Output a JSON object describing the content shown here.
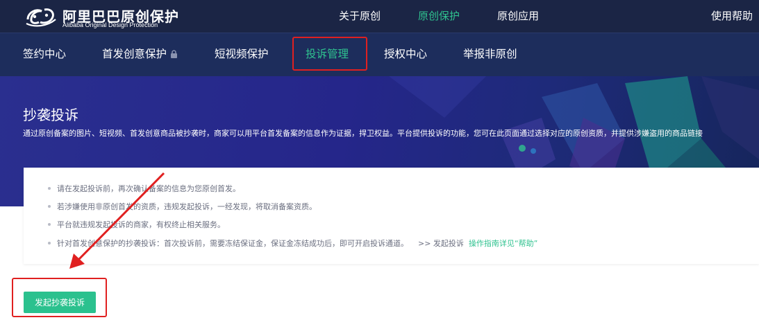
{
  "header": {
    "logo_cn": "阿里巴巴原创保护",
    "logo_en": "Alibaba Original Design Protection",
    "nav": [
      "关于原创",
      "原创保护",
      "原创应用"
    ],
    "active_nav": "原创保护",
    "help": "使用帮助"
  },
  "subnav": {
    "items": [
      "签约中心",
      "首发创意保护",
      "短视频保护",
      "投诉管理",
      "授权中心",
      "举报非原创"
    ],
    "active": "投诉管理",
    "locked_item": "首发创意保护"
  },
  "banner": {
    "title": "抄袭投诉",
    "description": "通过原创备案的图片、短视频、首发创意商品被抄袭时，商家可以用平台首发备案的信息作为证据，捍卫权益。平台提供投诉的功能，您可在此页面通过选择对应的原创资质，并提供涉嫌盗用的商品链接"
  },
  "notes": [
    "请在发起投诉前，再次确认备案的信息为您原创首发。",
    "若涉嫌使用非原创首发的资质，违规发起投诉，一经发现，将取消备案资质。",
    "平台就违规发起投诉的商家，有权终止相关服务。",
    "针对首发创意保护的抄袭投诉：首次投诉前，需要冻结保证金，保证金冻结成功后，即可开启投诉通道。"
  ],
  "notes_link": {
    "prefix": ">>  发起投诉",
    "help": "操作指南详见“帮助”"
  },
  "action": {
    "button_label": "发起抄袭投诉"
  },
  "colors": {
    "topbar": "#1b2545",
    "subbar": "#1d2d5c",
    "accent": "#2fc28f",
    "button": "#2bc18e",
    "annotation": "#e02020"
  }
}
